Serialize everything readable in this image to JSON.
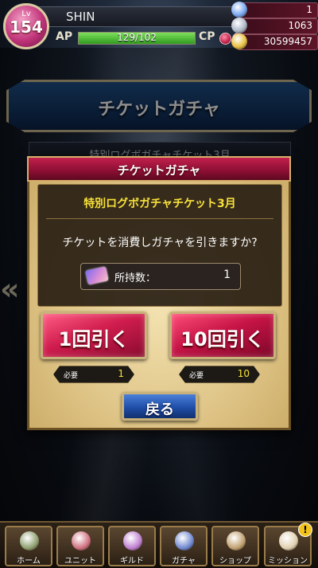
{
  "player": {
    "level_label": "Lv",
    "level": "154",
    "name": "SHIN",
    "ap_label": "AP",
    "ap_text": "129/102",
    "ap_fraction": 1.0,
    "cp_label": "CP",
    "cp_points": 3
  },
  "resources": [
    {
      "icon": "gem-icon",
      "value": "1",
      "color": "#7aa8f0"
    },
    {
      "icon": "stone-icon",
      "value": "1063",
      "color": "#b0b8c8"
    },
    {
      "icon": "coin-icon",
      "value": "30599457",
      "color": "#e8c040"
    }
  ],
  "background": {
    "banner_title": "チケットガチャ",
    "card_text": "特別ログボガチャチケット3月"
  },
  "modal": {
    "title": "チケットガチャ",
    "ticket_name": "特別ログボガチャチケット3月",
    "confirm_text": "チケットを消費しガチャを引きますか?",
    "owned_label": "所持数：",
    "owned_value": "1",
    "pull1_label": "1回引く",
    "pull10_label": "10回引く",
    "req_label": "必要",
    "req1_value": "1",
    "req10_value": "10",
    "back_label": "戻る"
  },
  "nav": {
    "items": [
      {
        "label": "ホーム",
        "icon": "home-icon",
        "color": "#8fa070"
      },
      {
        "label": "ユニット",
        "icon": "unit-icon",
        "color": "#d07080"
      },
      {
        "label": "ギルド",
        "icon": "guild-icon",
        "color": "#c080d0"
      },
      {
        "label": "ガチャ",
        "icon": "gacha-icon",
        "color": "#7088d0"
      },
      {
        "label": "ショップ",
        "icon": "shop-icon",
        "color": "#c0a070"
      },
      {
        "label": "ミッション",
        "icon": "mission-icon",
        "color": "#e0d0b0"
      }
    ],
    "alert_text": "!"
  }
}
